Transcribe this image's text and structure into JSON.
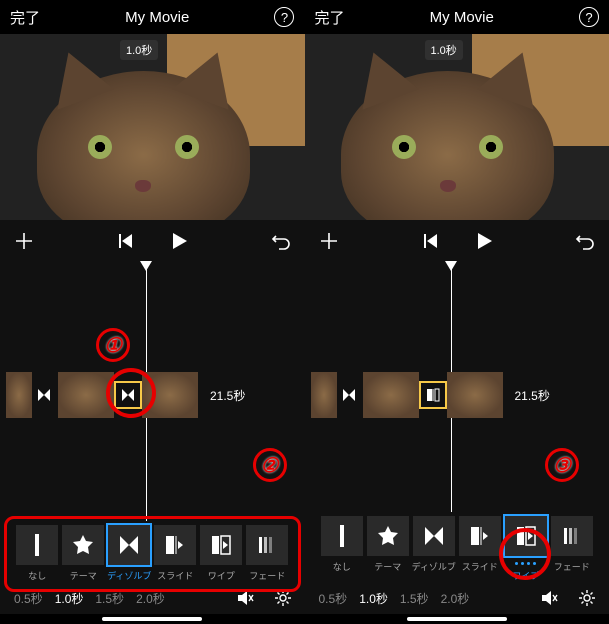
{
  "left": {
    "header": {
      "done": "完了",
      "title": "My Movie",
      "help": "?"
    },
    "preview_duration": "1.0秒",
    "timeline": {
      "remaining": "21.5秒"
    },
    "transitions": {
      "options": [
        {
          "key": "none",
          "label": "なし"
        },
        {
          "key": "theme",
          "label": "テーマ"
        },
        {
          "key": "dissolve",
          "label": "ディゾルブ"
        },
        {
          "key": "slide",
          "label": "スライド"
        },
        {
          "key": "wipe",
          "label": "ワイプ"
        },
        {
          "key": "fade",
          "label": "フェード"
        }
      ],
      "selected": "dissolve"
    },
    "durations": {
      "options": [
        "0.5秒",
        "1.0秒",
        "1.5秒",
        "2.0秒"
      ],
      "selected": "1.0秒"
    }
  },
  "right": {
    "header": {
      "done": "完了",
      "title": "My Movie",
      "help": "?"
    },
    "preview_duration": "1.0秒",
    "timeline": {
      "remaining": "21.5秒"
    },
    "transitions": {
      "options": [
        {
          "key": "none",
          "label": "なし"
        },
        {
          "key": "theme",
          "label": "テーマ"
        },
        {
          "key": "dissolve",
          "label": "ディゾルブ"
        },
        {
          "key": "slide",
          "label": "スライド"
        },
        {
          "key": "wipe",
          "label": "ワイプ"
        },
        {
          "key": "fade",
          "label": "フェード"
        }
      ],
      "selected": "wipe"
    },
    "durations": {
      "options": [
        "0.5秒",
        "1.0秒",
        "1.5秒",
        "2.0秒"
      ],
      "selected": "1.0秒"
    }
  },
  "annotations": {
    "one": "①",
    "two": "②",
    "three": "③"
  }
}
